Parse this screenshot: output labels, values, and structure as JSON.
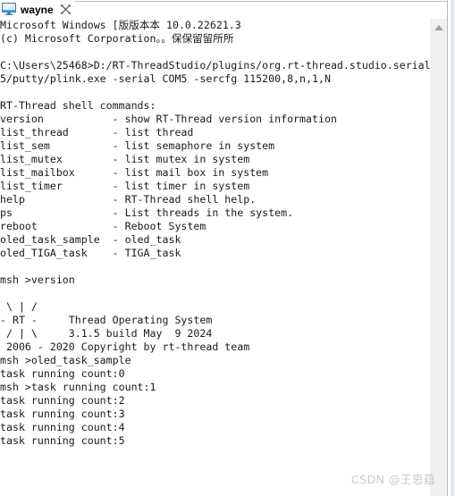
{
  "window": {
    "tab": {
      "icon": "monitor-terminal-icon",
      "label": "wayne",
      "close_icon": "close-icon"
    }
  },
  "scrollbar": {
    "up_arrow_icon": "scroll-up-arrow-icon"
  },
  "watermark": {
    "text": "CSDN @王思蕴"
  },
  "console": {
    "lines": [
      "Microsoft Windows [版版本本 10.0.22621.3",
      "(c) Microsoft Corporation。。保保留留所所",
      "",
      "C:\\Users\\25468>D:/RT-ThreadStudio/plugins/org.rt-thread.studio.serial.",
      "5/putty/plink.exe -serial COM5 -sercfg 115200,8,n,1,N",
      "",
      "RT-Thread shell commands:",
      "version           - show RT-Thread version information",
      "list_thread       - list thread",
      "list_sem          - list semaphore in system",
      "list_mutex        - list mutex in system",
      "list_mailbox      - list mail box in system",
      "list_timer        - list timer in system",
      "help              - RT-Thread shell help.",
      "ps                - List threads in the system.",
      "reboot            - Reboot System",
      "oled_task_sample  - oled_task",
      "oled_TIGA_task    - TIGA_task",
      "",
      "msh >version",
      "",
      " \\ | /",
      "- RT -     Thread Operating System",
      " / | \\     3.1.5 build May  9 2024",
      " 2006 - 2020 Copyright by rt-thread team",
      "msh >oled_task_sample",
      "task running count:0",
      "msh >task running count:1",
      "task running count:2",
      "task running count:3",
      "task running count:4",
      "task running count:5"
    ]
  }
}
